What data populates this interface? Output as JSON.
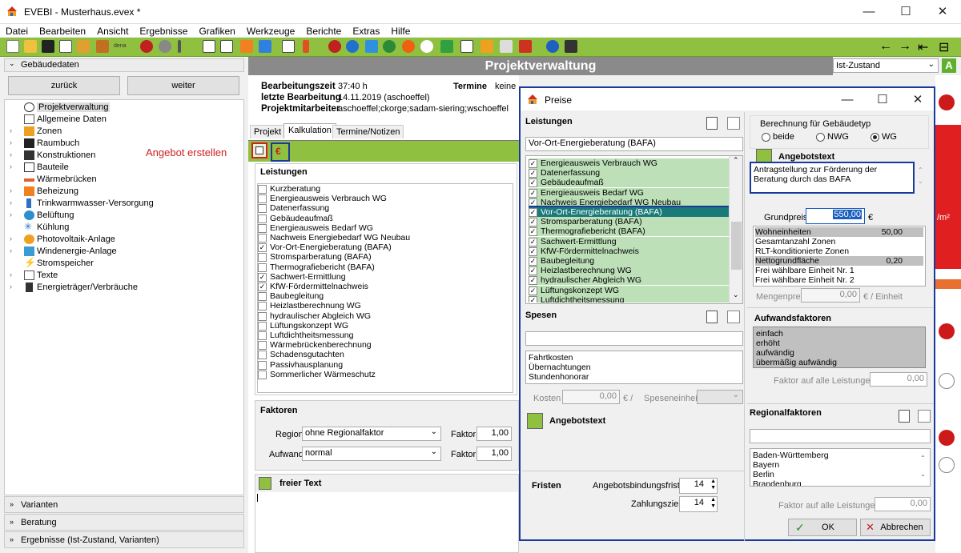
{
  "window": {
    "title": "EVEBI - Musterhaus.evex *",
    "minimize": "—",
    "maximize": "☐",
    "close": "✕"
  },
  "menu": [
    "Datei",
    "Bearbeiten",
    "Ansicht",
    "Ergebnisse",
    "Grafiken",
    "Werkzeuge",
    "Berichte",
    "Extras",
    "Hilfe"
  ],
  "toolbar": {
    "dena_label": "dena",
    "nav_back": "←",
    "nav_forward": "→",
    "extra1": "⇤",
    "extra2": "⊟"
  },
  "sidebar": {
    "header": "Gebäudedaten",
    "back_button": "zurück",
    "forward_button": "weiter",
    "tree": [
      {
        "label": "Projektverwaltung",
        "selected": true,
        "expandable": false
      },
      {
        "label": "Allgemeine Daten",
        "expandable": false
      },
      {
        "label": "Zonen",
        "expandable": true
      },
      {
        "label": "Raumbuch",
        "expandable": true
      },
      {
        "label": "Konstruktionen",
        "expandable": true
      },
      {
        "label": "Bauteile",
        "expandable": true
      },
      {
        "label": "Wärmebrücken",
        "expandable": false
      },
      {
        "label": "Beheizung",
        "expandable": true
      },
      {
        "label": "Trinkwarmwasser-Versorgung",
        "expandable": true
      },
      {
        "label": "Belüftung",
        "expandable": true
      },
      {
        "label": "Kühlung",
        "expandable": false
      },
      {
        "label": "Photovoltaik-Anlage",
        "expandable": true
      },
      {
        "label": "Windenergie-Anlage",
        "expandable": true
      },
      {
        "label": "Stromspeicher",
        "expandable": false
      },
      {
        "label": "Texte",
        "expandable": true
      },
      {
        "label": "Energieträger/Verbräuche",
        "expandable": true
      }
    ],
    "sections": [
      "Varianten",
      "Beratung",
      "Ergebnisse (Ist-Zustand, Varianten)"
    ],
    "annotation": "Angebot erstellen"
  },
  "main": {
    "title": "Projektverwaltung",
    "info": [
      {
        "label": "Bearbeitungszeit",
        "value": "37:40 h"
      },
      {
        "label": "letzte Bearbeitung",
        "value": "14.11.2019 (aschoeffel)"
      },
      {
        "label": "Projektmitarbeiter",
        "value": "aschoeffel;ckorge;sadam-siering;wschoeffel"
      }
    ],
    "termine_label": "Termine",
    "termine_value": "keine",
    "tabs": [
      "Projekt",
      "Kalkulation",
      "Termine/Notizen"
    ],
    "leistungen_header": "Leistungen",
    "leistungen": [
      {
        "label": "Kurzberatung",
        "checked": false
      },
      {
        "label": "Energieausweis Verbrauch WG",
        "checked": false
      },
      {
        "label": "Datenerfassung",
        "checked": false
      },
      {
        "label": "Gebäudeaufmaß",
        "checked": false
      },
      {
        "label": "Energieausweis Bedarf WG",
        "checked": false
      },
      {
        "label": "Nachweis Energiebedarf WG Neubau",
        "checked": false
      },
      {
        "label": "Vor-Ort-Energieberatung (BAFA)",
        "checked": true
      },
      {
        "label": "Stromsparberatung (BAFA)",
        "checked": false
      },
      {
        "label": "Thermografiebericht (BAFA)",
        "checked": false
      },
      {
        "label": "Sachwert-Ermittlung",
        "checked": true
      },
      {
        "label": "KfW-Fördermittelnachweis",
        "checked": true
      },
      {
        "label": "Baubegleitung",
        "checked": false
      },
      {
        "label": "Heizlastberechnung WG",
        "checked": false
      },
      {
        "label": "hydraulischer Abgleich WG",
        "checked": false
      },
      {
        "label": "Lüftungskonzept WG",
        "checked": false
      },
      {
        "label": "Luftdichtheitsmessung",
        "checked": false
      },
      {
        "label": "Wärmebrückenberechnung",
        "checked": false
      },
      {
        "label": "Schadensgutachten",
        "checked": false
      },
      {
        "label": "Passivhausplanung",
        "checked": false
      },
      {
        "label": "Sommerlicher Wärmeschutz",
        "checked": false
      }
    ],
    "faktoren_header": "Faktoren",
    "region_label": "Region",
    "region_value": "ohne Regionalfaktor",
    "aufwand_label": "Aufwand",
    "aufwand_value": "normal",
    "faktor_label": "Faktor",
    "faktor1": "1,00",
    "faktor2": "1,00",
    "freier_text": "freier Text"
  },
  "dialog": {
    "title": "Preise",
    "leistungen_header": "Leistungen",
    "filter_value": "Vor-Ort-Energieberatung (BAFA)",
    "items": [
      {
        "label": "Energieausweis Verbrauch WG",
        "checked": true
      },
      {
        "label": "Datenerfassung",
        "checked": true
      },
      {
        "label": "Gebäudeaufmaß",
        "checked": true
      },
      {
        "label": "Energieausweis Bedarf WG",
        "checked": true
      },
      {
        "label": "Nachweis Energiebedarf WG Neubau",
        "checked": true
      },
      {
        "label": "Vor-Ort-Energieberatung (BAFA)",
        "checked": true,
        "selected": true
      },
      {
        "label": "Stromsparberatung (BAFA)",
        "checked": true
      },
      {
        "label": "Thermografiebericht (BAFA)",
        "checked": true
      },
      {
        "label": "Sachwert-Ermittlung",
        "checked": true
      },
      {
        "label": "KfW-Fördermittelnachweis",
        "checked": true
      },
      {
        "label": "Baubegleitung",
        "checked": true
      },
      {
        "label": "Heizlastberechnung WG",
        "checked": true
      },
      {
        "label": "hydraulischer Abgleich WG",
        "checked": true
      },
      {
        "label": "Lüftungskonzept WG",
        "checked": true
      },
      {
        "label": "Luftdichtheitsmessung",
        "checked": true
      }
    ],
    "spesen_header": "Spesen",
    "spesen": [
      "Fahrtkosten",
      "Übernachtungen",
      "Stundenhonorar"
    ],
    "kosten_label": "Kosten",
    "kosten_value": "0,00",
    "euro_slash": "€ /",
    "speseneinheit_label": "Speseneinheit",
    "angebotstext_left": "Angebotstext",
    "fristen_header": "Fristen",
    "bindungsfrist_label": "Angebotsbindungsfrist",
    "bindungsfrist_value": "14",
    "zahlungsziel_label": "Zahlungsziel",
    "zahlungsziel_value": "14",
    "berechnung_label": "Berechnung für Gebäudetyp",
    "radio": [
      {
        "label": "beide",
        "selected": false
      },
      {
        "label": "NWG",
        "selected": false
      },
      {
        "label": "WG",
        "selected": true
      }
    ],
    "angebotstext_header": "Angebotstext",
    "angebotstext_value": "Antragstellung zur Förderung der Beratung durch das BAFA",
    "grundpreis_label": "Grundpreis",
    "grundpreis_value": "550,00",
    "euro": "€",
    "einheiten": [
      {
        "label": "Wohneinheiten",
        "value": "50,00"
      },
      {
        "label": "Gesamtanzahl Zonen",
        "value": ""
      },
      {
        "label": "RLT-konditionierte Zonen",
        "value": ""
      },
      {
        "label": "Nettogrundfläche",
        "value": "0,20"
      },
      {
        "label": "Frei wählbare Einheit Nr. 1",
        "value": ""
      },
      {
        "label": "Frei wählbare Einheit Nr. 2",
        "value": ""
      }
    ],
    "mengenpreis_label": "Mengenpreis",
    "mengenpreis_value": "0,00",
    "pro_einheit": "€ / Einheit",
    "aufwandsfaktoren_header": "Aufwandsfaktoren",
    "aufwandsfaktoren": [
      "einfach",
      "erhöht",
      "aufwändig",
      "übermäßig aufwändig"
    ],
    "faktor_alle_label": "Faktor auf alle Leistungen",
    "faktor_alle_value": "0,00",
    "regional_header": "Regionalfaktoren",
    "regional": [
      "Baden-Württemberg",
      "Bayern",
      "Berlin",
      "Brandenburg"
    ],
    "faktor_alle2_value": "0,00",
    "ok": "OK",
    "cancel": "Abbrechen"
  },
  "right": {
    "zustand": "Ist-Zustand",
    "m2": "/m²",
    "a_label": "A"
  }
}
